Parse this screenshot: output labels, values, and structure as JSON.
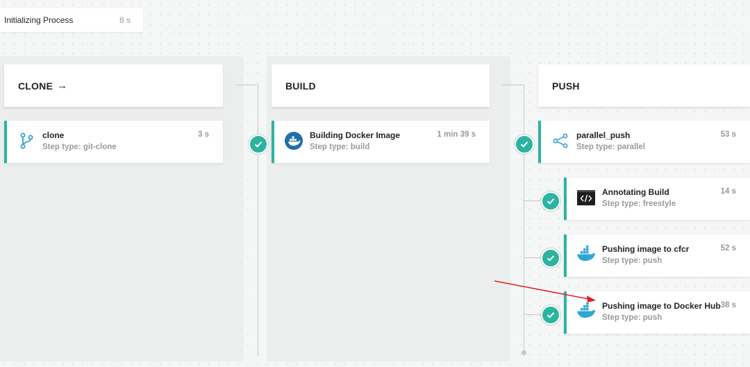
{
  "init": {
    "label": "Initializing Process",
    "duration": "8 s"
  },
  "stages": [
    {
      "title": "CLONE",
      "arrow": "→"
    },
    {
      "title": "BUILD"
    },
    {
      "title": "PUSH"
    }
  ],
  "steps": {
    "clone": {
      "title": "clone",
      "type": "Step type: git-clone",
      "duration": "3 s",
      "icon": "git-branch-icon"
    },
    "build": {
      "title": "Building Docker Image",
      "type": "Step type: build",
      "duration": "1 min 39 s",
      "icon": "docker-icon"
    },
    "parallel_push": {
      "title": "parallel_push",
      "type": "Step type: parallel",
      "duration": "53 s",
      "icon": "share-icon"
    },
    "annotate": {
      "title": "Annotating Build",
      "type": "Step type: freestyle",
      "duration": "14 s",
      "icon": "code-terminal-icon"
    },
    "push_cfcr": {
      "title": "Pushing image to cfcr",
      "type": "Step type: push",
      "duration": "52 s",
      "icon": "docker-whale-icon"
    },
    "push_dockerhub": {
      "title": "Pushing image to Docker Hub",
      "type": "Step type: push",
      "duration": "38 s",
      "icon": "docker-whale-icon"
    }
  },
  "colors": {
    "accent": "#2bb4a0",
    "annotation_arrow": "#e02020"
  }
}
